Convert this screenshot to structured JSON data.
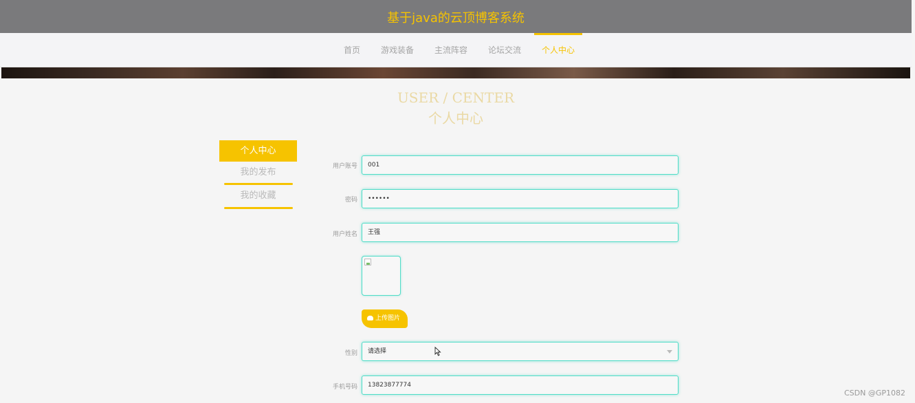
{
  "header": {
    "title": "基于java的云顶博客系统"
  },
  "nav": {
    "items": [
      {
        "label": "首页"
      },
      {
        "label": "游戏装备"
      },
      {
        "label": "主流阵容"
      },
      {
        "label": "论坛交流"
      },
      {
        "label": "个人中心"
      }
    ],
    "active_index": 4
  },
  "page_heading": {
    "en": "USER / CENTER",
    "zh": "个人中心"
  },
  "sidebar": {
    "items": [
      {
        "label": "个人中心"
      },
      {
        "label": "我的发布"
      },
      {
        "label": "我的收藏"
      }
    ],
    "active_index": 0
  },
  "form": {
    "account": {
      "label": "用户账号",
      "value": "001"
    },
    "password": {
      "label": "密码",
      "value": "••••••"
    },
    "name": {
      "label": "用户姓名",
      "value": "王强"
    },
    "upload": {
      "label": "上传图片"
    },
    "gender": {
      "label": "性别",
      "value": "请选择"
    },
    "phone": {
      "label": "手机号码",
      "value": "13823877774"
    }
  },
  "icons": {
    "upload": "cloud-upload-icon",
    "image": "broken-image-icon",
    "dropdown": "chevron-down-icon",
    "cursor": "mouse-cursor-icon"
  },
  "colors": {
    "accent": "#f6c300",
    "field_border": "#4fdcc7",
    "header_bg": "#7a7a7c"
  },
  "watermark": "CSDN @GP1082"
}
